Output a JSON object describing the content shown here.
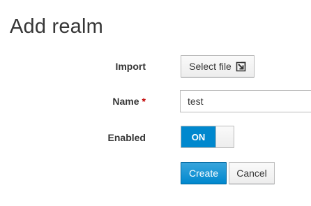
{
  "page": {
    "title": "Add realm"
  },
  "form": {
    "import": {
      "label": "Import",
      "button_label": "Select file",
      "icon": "import-file-icon"
    },
    "name": {
      "label": "Name",
      "required_mark": "*",
      "value": "test"
    },
    "enabled": {
      "label": "Enabled",
      "state_label": "ON",
      "value": true
    }
  },
  "actions": {
    "create_label": "Create",
    "cancel_label": "Cancel"
  },
  "colors": {
    "primary": "#0088ce",
    "required": "#c00000",
    "text": "#363636"
  }
}
